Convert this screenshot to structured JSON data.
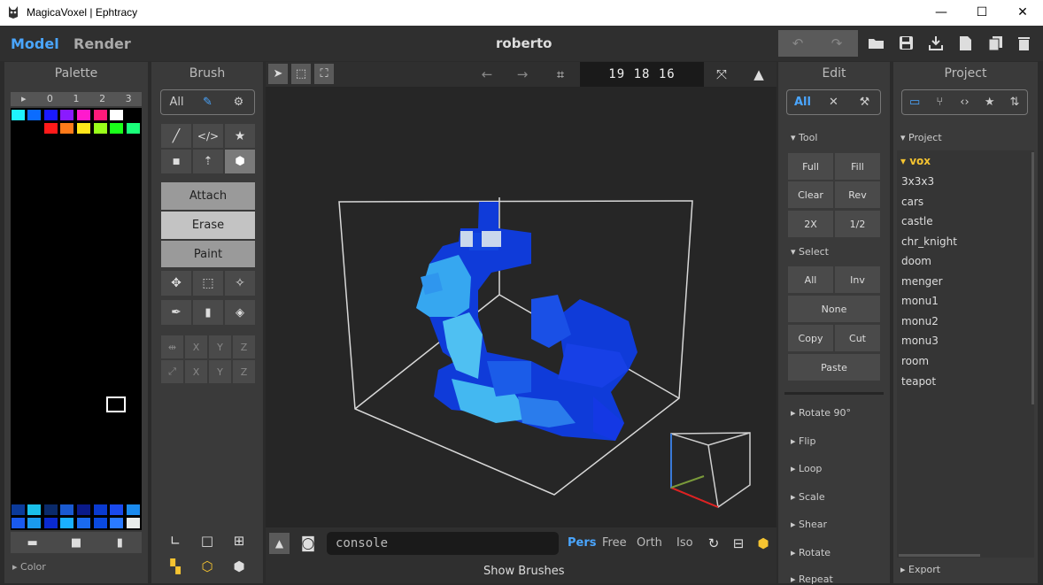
{
  "window": {
    "title": "MagicaVoxel | Ephtracy",
    "min": "—",
    "max": "☐",
    "close": "✕"
  },
  "header": {
    "tab_model": "Model",
    "tab_render": "Render",
    "file_name": "roberto"
  },
  "palette": {
    "title": "Palette",
    "tabs": [
      "▸",
      "0",
      "1",
      "2",
      "3"
    ],
    "footer_label": "Color"
  },
  "brush": {
    "title": "Brush",
    "filter_all": "All",
    "modes": [
      "Attach",
      "Erase",
      "Paint"
    ],
    "axis_rows": [
      [
        "X",
        "Y",
        "Z"
      ],
      [
        "X",
        "Y",
        "Z"
      ]
    ]
  },
  "viewport": {
    "coords": "19 18 16",
    "console_placeholder": "console",
    "views": [
      "Pers",
      "Free",
      "Orth",
      "Iso"
    ],
    "show_brushes": "Show Brushes"
  },
  "edit": {
    "title": "Edit",
    "filter_all": "All",
    "tool_label": "Tool",
    "tool_buttons": [
      "Full",
      "Fill",
      "Clear",
      "Rev",
      "2X",
      "1/2"
    ],
    "select_label": "Select",
    "select_buttons": [
      "All",
      "Inv",
      "None",
      "Copy",
      "Cut",
      "Paste"
    ],
    "actions": [
      "Rotate 90°",
      "Flip",
      "Loop",
      "Scale",
      "Shear",
      "Rotate",
      "Repeat"
    ]
  },
  "project": {
    "title": "Project",
    "section": "Project",
    "folder": "vox",
    "items": [
      "3x3x3",
      "cars",
      "castle",
      "chr_knight",
      "doom",
      "menger",
      "monu1",
      "monu2",
      "monu3",
      "room",
      "teapot"
    ],
    "export": "Export"
  },
  "colors": {
    "accent": "#4aa6ff",
    "folder": "#f5c431"
  }
}
